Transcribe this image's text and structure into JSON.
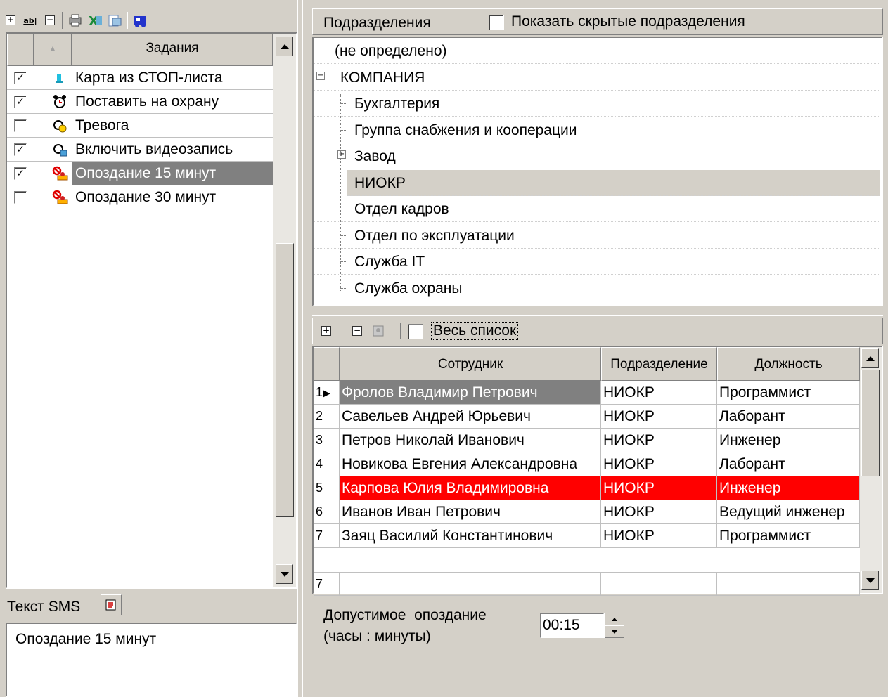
{
  "tasks_panel": {
    "header": "Задания",
    "sort_glyph": "▲",
    "rows": [
      {
        "label": "Карта из СТОП-листа",
        "checked": true,
        "icon": "card-icon"
      },
      {
        "label": "Поставить на охрану",
        "checked": true,
        "icon": "alarm-clock-icon"
      },
      {
        "label": "Тревога",
        "checked": false,
        "icon": "alarm-bulb-icon"
      },
      {
        "label": "Включить видеозапись",
        "checked": true,
        "icon": "video-record-icon"
      },
      {
        "label": "Опоздание 15 минут",
        "checked": true,
        "icon": "late-icon",
        "selected": true
      },
      {
        "label": "Опоздание 30 минут",
        "checked": false,
        "icon": "late-icon"
      }
    ]
  },
  "sms": {
    "label": "Текст SMS",
    "text": "Опоздание 15 минут"
  },
  "departments": {
    "title": "Подразделения",
    "show_hidden_label": "Показать скрытые подразделения",
    "tree": [
      {
        "label": "(не определено)",
        "level": 0
      },
      {
        "label": "КОМПАНИЯ",
        "level": 0,
        "expander": "⊟"
      },
      {
        "label": "Бухгалтерия",
        "level": 1
      },
      {
        "label": "Группа снабжения и кооперации",
        "level": 1
      },
      {
        "label": "Завод",
        "level": 1,
        "expander": "⊞"
      },
      {
        "label": "НИОКР",
        "level": 1,
        "selected": true
      },
      {
        "label": "Отдел кадров",
        "level": 1
      },
      {
        "label": "Отдел по эксплуатации",
        "level": 1
      },
      {
        "label": "Служба IT",
        "level": 1
      },
      {
        "label": "Служба охраны",
        "level": 1
      }
    ]
  },
  "employees": {
    "full_list_label": "Весь список",
    "columns": [
      "Сотрудник",
      "Подразделение",
      "Должность"
    ],
    "rows": [
      {
        "n": "1",
        "name": "Фролов Владимир Петрович",
        "dept": "НИОКР",
        "pos": "Программист",
        "state": "current"
      },
      {
        "n": "2",
        "name": "Савельев Андрей Юрьевич",
        "dept": "НИОКР",
        "pos": "Лаборант"
      },
      {
        "n": "3",
        "name": "Петров Николай Иванович",
        "dept": "НИОКР",
        "pos": "Инженер"
      },
      {
        "n": "4",
        "name": "Новикова Евгения Александровна",
        "dept": "НИОКР",
        "pos": "Лаборант"
      },
      {
        "n": "5",
        "name": "Карпова Юлия Владимировна",
        "dept": "НИОКР",
        "pos": "Инженер",
        "state": "highlight"
      },
      {
        "n": "6",
        "name": "Иванов Иван Петрович",
        "dept": "НИОКР",
        "pos": "Ведущий инженер"
      },
      {
        "n": "7",
        "name": "Заяц Василий Константинович",
        "dept": "НИОКР",
        "pos": "Программист"
      }
    ],
    "footer_count": "7"
  },
  "lateness": {
    "label_line1": "Допустимое  опоздание",
    "label_line2": "(часы : минуты)",
    "value": "00:15"
  },
  "colors": {
    "face": "#d4d0c8",
    "selected_gray": "#808080",
    "highlight_red": "#ff0000",
    "tree_selected": "#d4d0c8"
  }
}
